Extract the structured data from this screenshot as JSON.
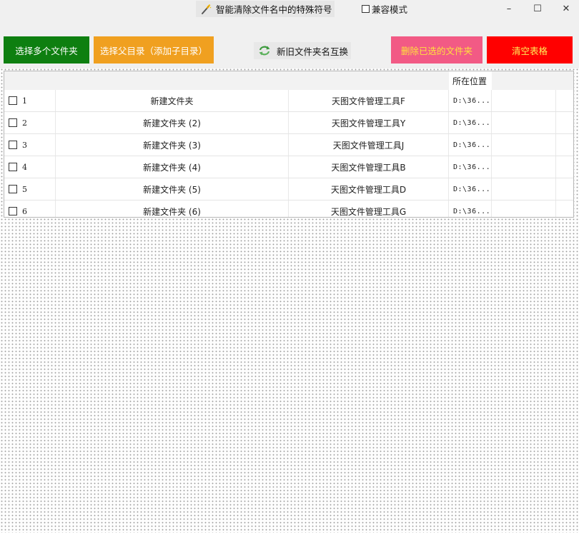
{
  "window": {
    "title": "智能清除文件名中的特殊符号",
    "compat_mode_label": "兼容模式",
    "minimize": "–",
    "maximize": "☐",
    "close": "✕"
  },
  "toolbar": {
    "select_multi": "选择多个文件夹",
    "select_parent": "选择父目录（添加子目录）",
    "swap_names": "新旧文件夹名互换",
    "delete_selected": "删除已选的文件夹",
    "clear_table": "清空表格"
  },
  "table": {
    "header_location": "所在位置",
    "rows": [
      {
        "index": "1",
        "name": "新建文件夹",
        "tool": "天图文件管理工具F",
        "path": "D:\\36..."
      },
      {
        "index": "2",
        "name": "新建文件夹 (2)",
        "tool": "天图文件管理工具Y",
        "path": "D:\\36..."
      },
      {
        "index": "3",
        "name": "新建文件夹 (3)",
        "tool": "天图文件管理工具J",
        "path": "D:\\36..."
      },
      {
        "index": "4",
        "name": "新建文件夹 (4)",
        "tool": "天图文件管理工具B",
        "path": "D:\\36..."
      },
      {
        "index": "5",
        "name": "新建文件夹 (5)",
        "tool": "天图文件管理工具D",
        "path": "D:\\36..."
      },
      {
        "index": "6",
        "name": "新建文件夹 (6)",
        "tool": "天图文件管理工具G",
        "path": "D:\\36..."
      }
    ]
  },
  "colors": {
    "green_button": "#0e7f10",
    "orange_button": "#f0a020",
    "pink_button": "#f25a85",
    "red_button": "#ff0000"
  },
  "icons": {
    "title": "magic-wand-icon",
    "swap": "refresh-arrows-icon"
  }
}
